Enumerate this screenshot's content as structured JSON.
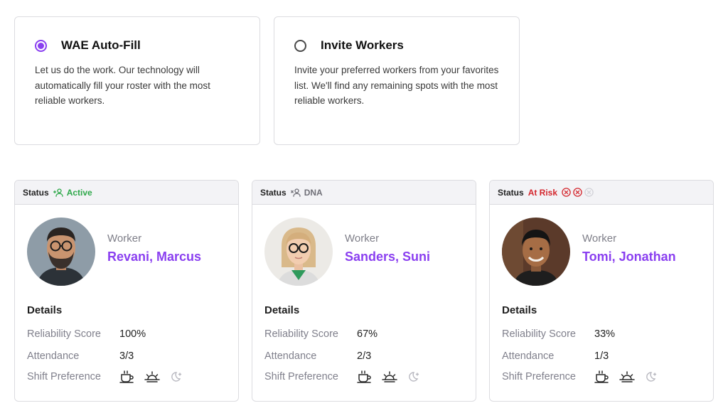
{
  "options": [
    {
      "title": "WAE Auto-Fill",
      "description": "Let us do the work. Our technology will automatically fill your roster with the most reliable workers.",
      "selected": true
    },
    {
      "title": "Invite Workers",
      "description": "Invite your preferred workers from your favorites list. We'll find any remaining spots with the most reliable workers.",
      "selected": false
    }
  ],
  "workers": [
    {
      "status_label": "Status",
      "status": "Active",
      "status_icon": "user-check-icon",
      "role": "Worker",
      "name": "Revani, Marcus",
      "details_title": "Details",
      "reliability_label": "Reliability Score",
      "reliability": "100%",
      "attendance_label": "Attendance",
      "attendance": "3/3",
      "shift_label": "Shift Preference"
    },
    {
      "status_label": "Status",
      "status": "DNA",
      "status_icon": "user-x-icon",
      "role": "Worker",
      "name": "Sanders, Suni",
      "details_title": "Details",
      "reliability_label": "Reliability Score",
      "reliability": "67%",
      "attendance_label": "Attendance",
      "attendance": "2/3",
      "shift_label": "Shift Preference"
    },
    {
      "status_label": "Status",
      "status": "At Risk",
      "status_icon": "x-circle-icon",
      "role": "Worker",
      "name": "Tomi, Jonathan",
      "details_title": "Details",
      "reliability_label": "Reliability Score",
      "reliability": "33%",
      "attendance_label": "Attendance",
      "attendance": "1/3",
      "shift_label": "Shift Preference"
    }
  ],
  "colors": {
    "accent": "#8a3ff0",
    "active": "#2ea84a",
    "dna": "#707078",
    "risk": "#d4262d"
  }
}
